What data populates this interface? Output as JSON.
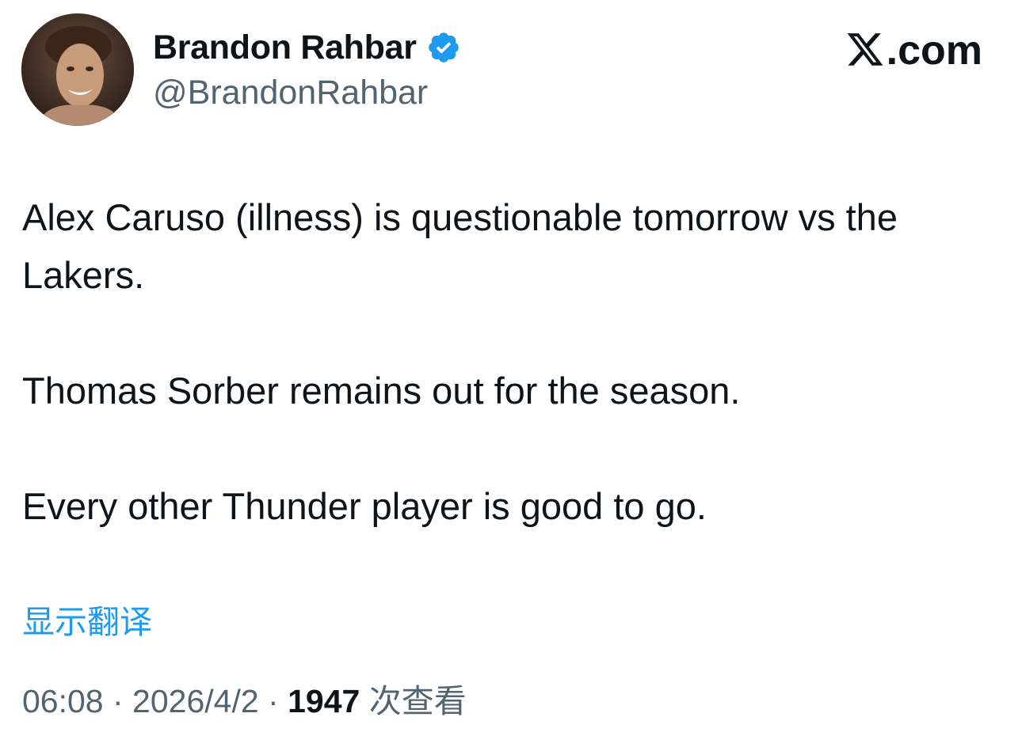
{
  "author": {
    "name": "Brandon Rahbar",
    "handle": "@BrandonRahbar",
    "verified": true,
    "avatar_icon": "profile-photo"
  },
  "brand": {
    "icon": "x-logo-icon",
    "domain_suffix": ".com"
  },
  "tweet": {
    "paragraphs": [
      "Alex Caruso (illness) is questionable tomorrow vs the Lakers.",
      "Thomas Sorber remains out for the season.",
      "Every other Thunder player is good to go."
    ]
  },
  "translate_label": "显示翻译",
  "meta": {
    "time": "06:08",
    "separator": " · ",
    "date": "2026/4/2",
    "views_count": "1947",
    "views_label": " 次查看"
  },
  "colors": {
    "text": "#0f1419",
    "secondary": "#536471",
    "link": "#1d9bf0",
    "verified_badge": "#1d9bf0"
  }
}
